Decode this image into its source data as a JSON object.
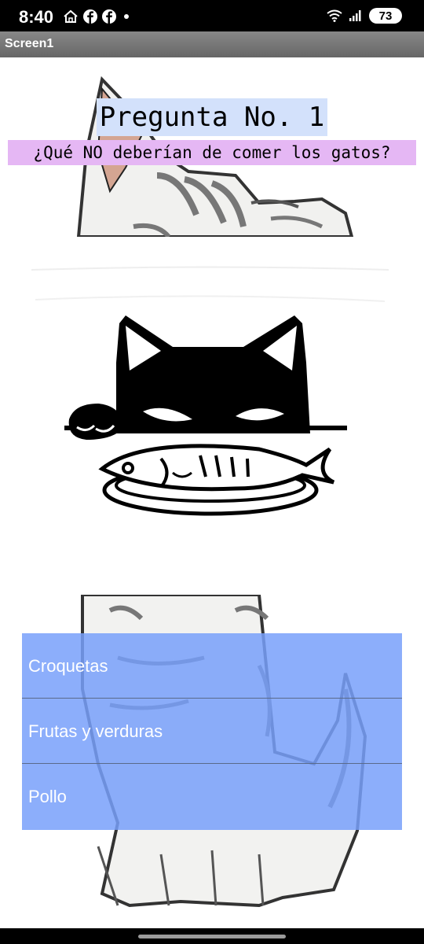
{
  "status": {
    "time": "8:40",
    "battery": "73",
    "icons": [
      "home-icon",
      "facebook-icon",
      "facebook-icon",
      "notification-dot",
      "wifi-icon",
      "signal-icon",
      "battery-icon"
    ]
  },
  "app": {
    "title": "Screen1"
  },
  "question": {
    "title": "Pregunta No. 1",
    "text": "¿Qué NO deberían de comer los gatos?"
  },
  "answers": [
    {
      "label": "Croquetas"
    },
    {
      "label": "Frutas y verduras"
    },
    {
      "label": "Pollo"
    }
  ],
  "colors": {
    "title_highlight": "#d3e1fb",
    "question_highlight": "#e5b7f4",
    "answer_bg": "#78a0fa"
  }
}
